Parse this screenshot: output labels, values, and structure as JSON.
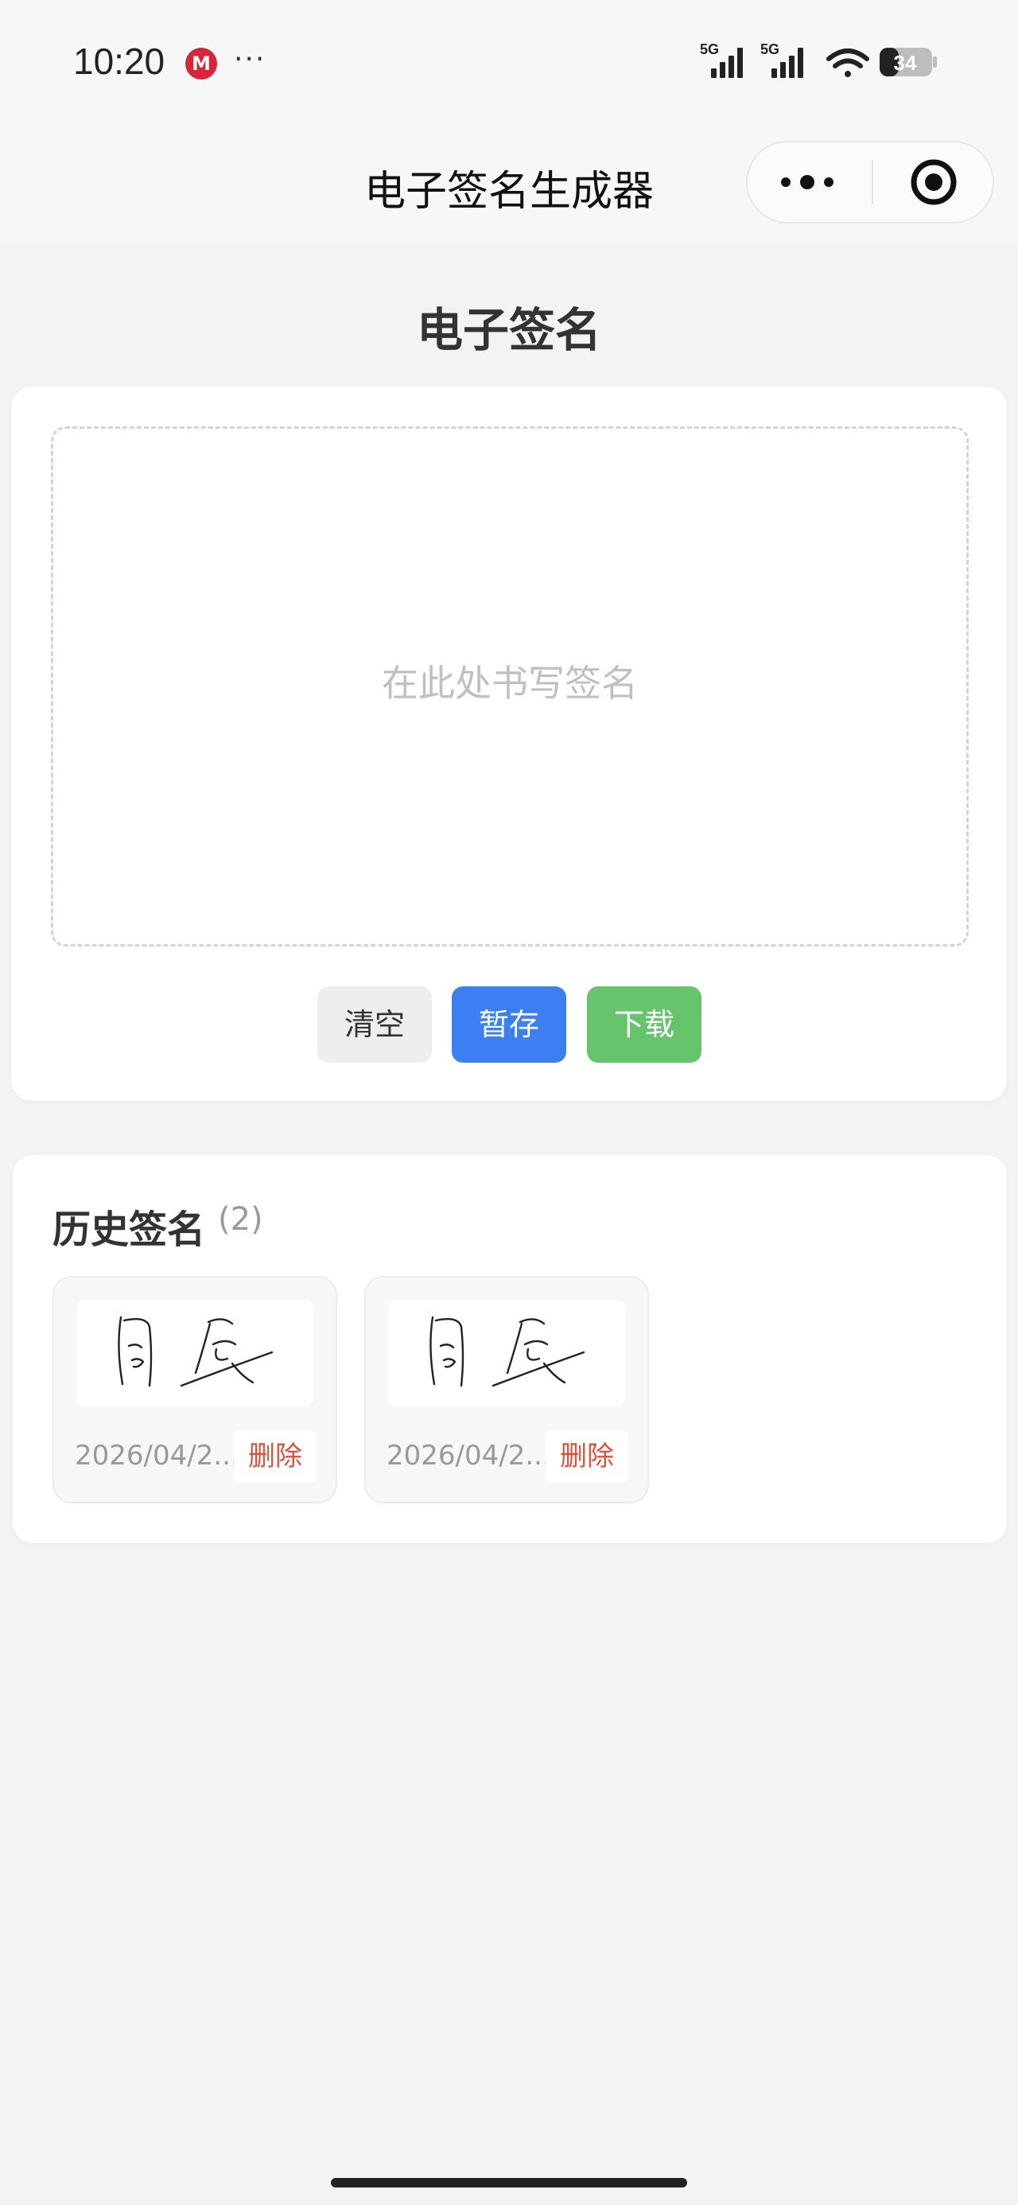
{
  "status_bar": {
    "time": "10:20",
    "app_badge": "M",
    "more": "···",
    "network_1": "5G",
    "network_2": "5G",
    "battery": "34"
  },
  "nav": {
    "title": "电子签名生成器"
  },
  "page": {
    "heading": "电子签名"
  },
  "signature_pad": {
    "placeholder": "在此处书写签名"
  },
  "actions": {
    "clear": "清空",
    "save": "暂存",
    "download": "下载"
  },
  "history": {
    "title": "历史签名",
    "count": "(2)",
    "items": [
      {
        "date": "2026/04/2...",
        "delete": "删除"
      },
      {
        "date": "2026/04/2...",
        "delete": "删除"
      }
    ]
  },
  "colors": {
    "primary": "#3b7ff2",
    "success": "#66c46d",
    "danger": "#d9533f",
    "background": "#f3f3f3"
  }
}
